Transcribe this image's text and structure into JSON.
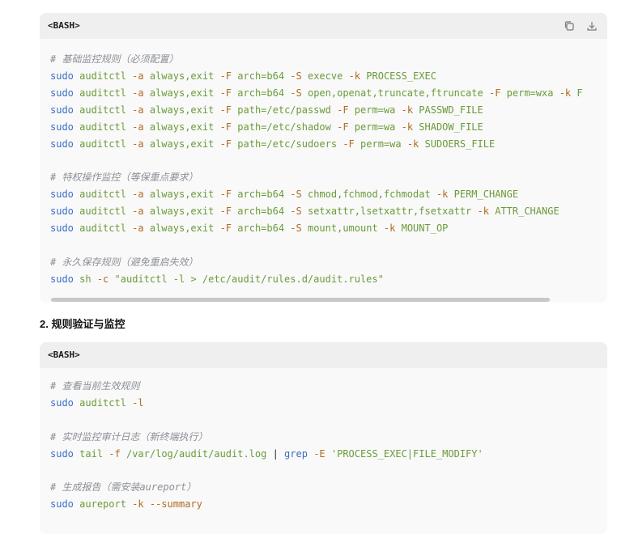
{
  "block1": {
    "lang": "<BASH>",
    "copy_icon": "copy-icon",
    "download_icon": "download-icon",
    "lines": [
      [
        {
          "c": "cm",
          "t": "# 基础监控规则（必须配置）"
        }
      ],
      [
        {
          "c": "kw",
          "t": "sudo"
        },
        {
          "c": "tx",
          "t": " "
        },
        {
          "c": "ar",
          "t": "auditctl"
        },
        {
          "c": "tx",
          "t": " "
        },
        {
          "c": "fl",
          "t": "-a"
        },
        {
          "c": "tx",
          "t": " "
        },
        {
          "c": "ar",
          "t": "always,exit"
        },
        {
          "c": "tx",
          "t": " "
        },
        {
          "c": "fl",
          "t": "-F"
        },
        {
          "c": "tx",
          "t": " "
        },
        {
          "c": "ar",
          "t": "arch=b64"
        },
        {
          "c": "tx",
          "t": " "
        },
        {
          "c": "fl",
          "t": "-S"
        },
        {
          "c": "tx",
          "t": " "
        },
        {
          "c": "ar",
          "t": "execve"
        },
        {
          "c": "tx",
          "t": " "
        },
        {
          "c": "fl",
          "t": "-k"
        },
        {
          "c": "tx",
          "t": " "
        },
        {
          "c": "ar",
          "t": "PROCESS_EXEC"
        }
      ],
      [
        {
          "c": "kw",
          "t": "sudo"
        },
        {
          "c": "tx",
          "t": " "
        },
        {
          "c": "ar",
          "t": "auditctl"
        },
        {
          "c": "tx",
          "t": " "
        },
        {
          "c": "fl",
          "t": "-a"
        },
        {
          "c": "tx",
          "t": " "
        },
        {
          "c": "ar",
          "t": "always,exit"
        },
        {
          "c": "tx",
          "t": " "
        },
        {
          "c": "fl",
          "t": "-F"
        },
        {
          "c": "tx",
          "t": " "
        },
        {
          "c": "ar",
          "t": "arch=b64"
        },
        {
          "c": "tx",
          "t": " "
        },
        {
          "c": "fl",
          "t": "-S"
        },
        {
          "c": "tx",
          "t": " "
        },
        {
          "c": "ar",
          "t": "open,openat,truncate,ftruncate"
        },
        {
          "c": "tx",
          "t": " "
        },
        {
          "c": "fl",
          "t": "-F"
        },
        {
          "c": "tx",
          "t": " "
        },
        {
          "c": "ar",
          "t": "perm=wxa"
        },
        {
          "c": "tx",
          "t": " "
        },
        {
          "c": "fl",
          "t": "-k"
        },
        {
          "c": "tx",
          "t": " "
        },
        {
          "c": "ar",
          "t": "F"
        }
      ],
      [
        {
          "c": "kw",
          "t": "sudo"
        },
        {
          "c": "tx",
          "t": " "
        },
        {
          "c": "ar",
          "t": "auditctl"
        },
        {
          "c": "tx",
          "t": " "
        },
        {
          "c": "fl",
          "t": "-a"
        },
        {
          "c": "tx",
          "t": " "
        },
        {
          "c": "ar",
          "t": "always,exit"
        },
        {
          "c": "tx",
          "t": " "
        },
        {
          "c": "fl",
          "t": "-F"
        },
        {
          "c": "tx",
          "t": " "
        },
        {
          "c": "ar",
          "t": "path=/etc/passwd"
        },
        {
          "c": "tx",
          "t": " "
        },
        {
          "c": "fl",
          "t": "-F"
        },
        {
          "c": "tx",
          "t": " "
        },
        {
          "c": "ar",
          "t": "perm=wa"
        },
        {
          "c": "tx",
          "t": " "
        },
        {
          "c": "fl",
          "t": "-k"
        },
        {
          "c": "tx",
          "t": " "
        },
        {
          "c": "ar",
          "t": "PASSWD_FILE"
        }
      ],
      [
        {
          "c": "kw",
          "t": "sudo"
        },
        {
          "c": "tx",
          "t": " "
        },
        {
          "c": "ar",
          "t": "auditctl"
        },
        {
          "c": "tx",
          "t": " "
        },
        {
          "c": "fl",
          "t": "-a"
        },
        {
          "c": "tx",
          "t": " "
        },
        {
          "c": "ar",
          "t": "always,exit"
        },
        {
          "c": "tx",
          "t": " "
        },
        {
          "c": "fl",
          "t": "-F"
        },
        {
          "c": "tx",
          "t": " "
        },
        {
          "c": "ar",
          "t": "path=/etc/shadow"
        },
        {
          "c": "tx",
          "t": " "
        },
        {
          "c": "fl",
          "t": "-F"
        },
        {
          "c": "tx",
          "t": " "
        },
        {
          "c": "ar",
          "t": "perm=wa"
        },
        {
          "c": "tx",
          "t": " "
        },
        {
          "c": "fl",
          "t": "-k"
        },
        {
          "c": "tx",
          "t": " "
        },
        {
          "c": "ar",
          "t": "SHADOW_FILE"
        }
      ],
      [
        {
          "c": "kw",
          "t": "sudo"
        },
        {
          "c": "tx",
          "t": " "
        },
        {
          "c": "ar",
          "t": "auditctl"
        },
        {
          "c": "tx",
          "t": " "
        },
        {
          "c": "fl",
          "t": "-a"
        },
        {
          "c": "tx",
          "t": " "
        },
        {
          "c": "ar",
          "t": "always,exit"
        },
        {
          "c": "tx",
          "t": " "
        },
        {
          "c": "fl",
          "t": "-F"
        },
        {
          "c": "tx",
          "t": " "
        },
        {
          "c": "ar",
          "t": "path=/etc/sudoers"
        },
        {
          "c": "tx",
          "t": " "
        },
        {
          "c": "fl",
          "t": "-F"
        },
        {
          "c": "tx",
          "t": " "
        },
        {
          "c": "ar",
          "t": "perm=wa"
        },
        {
          "c": "tx",
          "t": " "
        },
        {
          "c": "fl",
          "t": "-k"
        },
        {
          "c": "tx",
          "t": " "
        },
        {
          "c": "ar",
          "t": "SUDOERS_FILE"
        }
      ],
      [],
      [
        {
          "c": "cm",
          "t": "# 特权操作监控（等保重点要求）"
        }
      ],
      [
        {
          "c": "kw",
          "t": "sudo"
        },
        {
          "c": "tx",
          "t": " "
        },
        {
          "c": "ar",
          "t": "auditctl"
        },
        {
          "c": "tx",
          "t": " "
        },
        {
          "c": "fl",
          "t": "-a"
        },
        {
          "c": "tx",
          "t": " "
        },
        {
          "c": "ar",
          "t": "always,exit"
        },
        {
          "c": "tx",
          "t": " "
        },
        {
          "c": "fl",
          "t": "-F"
        },
        {
          "c": "tx",
          "t": " "
        },
        {
          "c": "ar",
          "t": "arch=b64"
        },
        {
          "c": "tx",
          "t": " "
        },
        {
          "c": "fl",
          "t": "-S"
        },
        {
          "c": "tx",
          "t": " "
        },
        {
          "c": "ar",
          "t": "chmod,fchmod,fchmodat"
        },
        {
          "c": "tx",
          "t": " "
        },
        {
          "c": "fl",
          "t": "-k"
        },
        {
          "c": "tx",
          "t": " "
        },
        {
          "c": "ar",
          "t": "PERM_CHANGE"
        }
      ],
      [
        {
          "c": "kw",
          "t": "sudo"
        },
        {
          "c": "tx",
          "t": " "
        },
        {
          "c": "ar",
          "t": "auditctl"
        },
        {
          "c": "tx",
          "t": " "
        },
        {
          "c": "fl",
          "t": "-a"
        },
        {
          "c": "tx",
          "t": " "
        },
        {
          "c": "ar",
          "t": "always,exit"
        },
        {
          "c": "tx",
          "t": " "
        },
        {
          "c": "fl",
          "t": "-F"
        },
        {
          "c": "tx",
          "t": " "
        },
        {
          "c": "ar",
          "t": "arch=b64"
        },
        {
          "c": "tx",
          "t": " "
        },
        {
          "c": "fl",
          "t": "-S"
        },
        {
          "c": "tx",
          "t": " "
        },
        {
          "c": "ar",
          "t": "setxattr,lsetxattr,fsetxattr"
        },
        {
          "c": "tx",
          "t": " "
        },
        {
          "c": "fl",
          "t": "-k"
        },
        {
          "c": "tx",
          "t": " "
        },
        {
          "c": "ar",
          "t": "ATTR_CHANGE"
        }
      ],
      [
        {
          "c": "kw",
          "t": "sudo"
        },
        {
          "c": "tx",
          "t": " "
        },
        {
          "c": "ar",
          "t": "auditctl"
        },
        {
          "c": "tx",
          "t": " "
        },
        {
          "c": "fl",
          "t": "-a"
        },
        {
          "c": "tx",
          "t": " "
        },
        {
          "c": "ar",
          "t": "always,exit"
        },
        {
          "c": "tx",
          "t": " "
        },
        {
          "c": "fl",
          "t": "-F"
        },
        {
          "c": "tx",
          "t": " "
        },
        {
          "c": "ar",
          "t": "arch=b64"
        },
        {
          "c": "tx",
          "t": " "
        },
        {
          "c": "fl",
          "t": "-S"
        },
        {
          "c": "tx",
          "t": " "
        },
        {
          "c": "ar",
          "t": "mount,umount"
        },
        {
          "c": "tx",
          "t": " "
        },
        {
          "c": "fl",
          "t": "-k"
        },
        {
          "c": "tx",
          "t": " "
        },
        {
          "c": "ar",
          "t": "MOUNT_OP"
        }
      ],
      [],
      [
        {
          "c": "cm",
          "t": "# 永久保存规则（避免重启失效）"
        }
      ],
      [
        {
          "c": "kw",
          "t": "sudo"
        },
        {
          "c": "tx",
          "t": " "
        },
        {
          "c": "ar",
          "t": "sh"
        },
        {
          "c": "tx",
          "t": " "
        },
        {
          "c": "fl",
          "t": "-c"
        },
        {
          "c": "tx",
          "t": " "
        },
        {
          "c": "ar",
          "t": "\"auditctl -l > /etc/audit/rules.d/audit.rules\""
        }
      ]
    ]
  },
  "section_title": "2. 规则验证与监控",
  "block2": {
    "lang": "<BASH>",
    "lines": [
      [
        {
          "c": "cm",
          "t": "# 查看当前生效规则"
        }
      ],
      [
        {
          "c": "kw",
          "t": "sudo"
        },
        {
          "c": "tx",
          "t": " "
        },
        {
          "c": "ar",
          "t": "auditctl"
        },
        {
          "c": "tx",
          "t": " "
        },
        {
          "c": "fl",
          "t": "-l"
        }
      ],
      [],
      [
        {
          "c": "cm",
          "t": "# 实时监控审计日志（新终端执行）"
        }
      ],
      [
        {
          "c": "kw",
          "t": "sudo"
        },
        {
          "c": "tx",
          "t": " "
        },
        {
          "c": "ar",
          "t": "tail"
        },
        {
          "c": "tx",
          "t": " "
        },
        {
          "c": "fl",
          "t": "-f"
        },
        {
          "c": "tx",
          "t": " "
        },
        {
          "c": "ar",
          "t": "/var/log/audit/audit.log"
        },
        {
          "c": "tx",
          "t": " | "
        },
        {
          "c": "kw",
          "t": "grep"
        },
        {
          "c": "tx",
          "t": " "
        },
        {
          "c": "fl",
          "t": "-E"
        },
        {
          "c": "tx",
          "t": " "
        },
        {
          "c": "ar",
          "t": "'PROCESS_EXEC|FILE_MODIFY'"
        }
      ],
      [],
      [
        {
          "c": "cm",
          "t": "# 生成报告（需安装aureport）"
        }
      ],
      [
        {
          "c": "kw",
          "t": "sudo"
        },
        {
          "c": "tx",
          "t": " "
        },
        {
          "c": "ar",
          "t": "aureport"
        },
        {
          "c": "tx",
          "t": " "
        },
        {
          "c": "fl",
          "t": "-k"
        },
        {
          "c": "tx",
          "t": " "
        },
        {
          "c": "fl",
          "t": "--summary"
        }
      ]
    ]
  }
}
